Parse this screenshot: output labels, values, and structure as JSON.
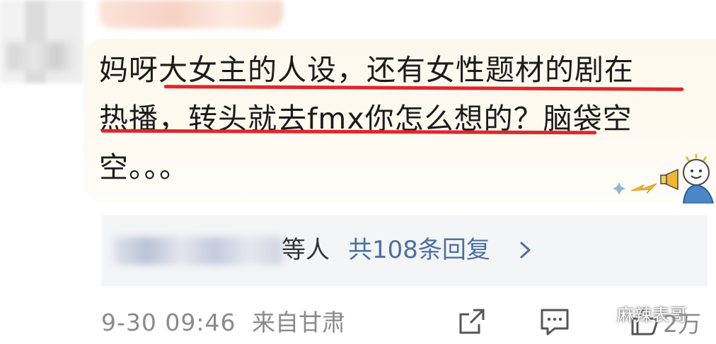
{
  "comment": {
    "line1": "妈呀大女主的人设，还有女性题材的剧在",
    "line2": "热播，转头就去fmx你怎么想的？脑袋空",
    "line3": "空。。。"
  },
  "replies": {
    "suffix": "等人",
    "link_label": "共108条回复",
    "link_color": "#4a6fa5"
  },
  "meta": {
    "date": "9-30 09:46",
    "location": "来自甘肃"
  },
  "actions": {
    "like_count": "2万"
  },
  "watermark": {
    "text": "麻辣表哥"
  },
  "colors": {
    "underline": "#e0262c",
    "bubble_bg": "#fdf8ec",
    "reply_bg": "#f4f5f7"
  },
  "icons": [
    "share-icon",
    "comment-icon",
    "like-icon",
    "chevron-right-icon",
    "wechat-logo-icon",
    "mascot-sticker"
  ]
}
